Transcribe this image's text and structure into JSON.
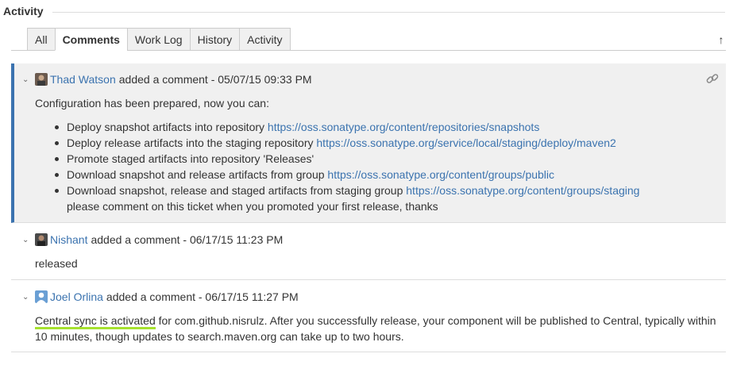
{
  "section": {
    "title": "Activity"
  },
  "tabs": [
    {
      "label": "All"
    },
    {
      "label": "Comments"
    },
    {
      "label": "Work Log"
    },
    {
      "label": "History"
    },
    {
      "label": "Activity"
    }
  ],
  "scroll_top_icon": "arrow-up-icon",
  "comments": [
    {
      "author": "Thad Watson",
      "meta": "added a comment - 05/07/15 09:33 PM",
      "intro": "Configuration has been prepared, now you can:",
      "items": [
        {
          "text": "Deploy snapshot artifacts into repository",
          "link": "https://oss.sonatype.org/content/repositories/snapshots"
        },
        {
          "text": "Deploy release artifacts into the staging repository",
          "link": "https://oss.sonatype.org/service/local/staging/deploy/maven2"
        },
        {
          "text": "Promote staged artifacts into repository 'Releases'",
          "link": ""
        },
        {
          "text": "Download snapshot and release artifacts from group",
          "link": "https://oss.sonatype.org/content/groups/public"
        },
        {
          "text": "Download snapshot, release and staged artifacts from staging group",
          "link": "https://oss.sonatype.org/content/groups/staging",
          "note": "please comment on this ticket when you promoted your first release, thanks"
        }
      ]
    },
    {
      "author": "Nishant",
      "meta": "added a comment - 06/17/15 11:23 PM",
      "body": "released"
    },
    {
      "author": "Joel Orlina",
      "meta": "added a comment - 06/17/15 11:27 PM",
      "body_highlight": "Central sync is activated",
      "body_rest": " for com.github.nisrulz. After you successfully release, your component will be published to Central, typically within 10 minutes, though updates to search.maven.org can take up to two hours."
    }
  ],
  "colors": {
    "link": "#3b73af",
    "focus_border": "#3b73af",
    "highlight": "#a6e22e",
    "focused_bg": "#f0f0f0"
  }
}
